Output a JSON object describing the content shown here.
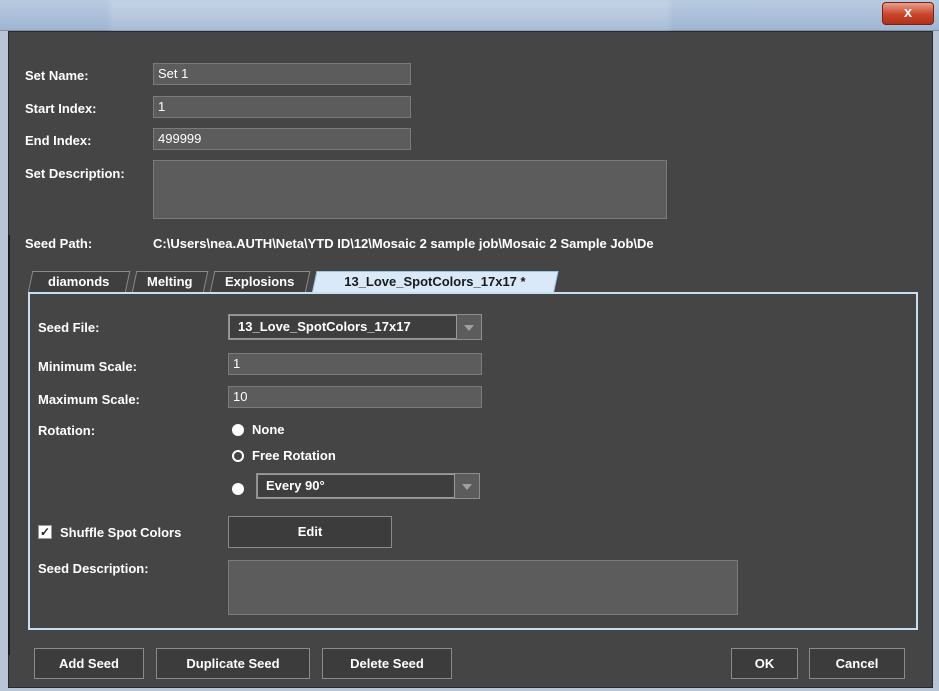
{
  "titlebar": {
    "close_symbol": "x"
  },
  "form": {
    "set_name_label": "Set Name:",
    "set_name_value": "Set 1",
    "start_index_label": "Start Index:",
    "start_index_value": "1",
    "end_index_label": "End Index:",
    "end_index_value": "499999",
    "set_description_label": "Set Description:",
    "seed_path_label": "Seed Path:",
    "seed_path_value": "C:\\Users\\nea.AUTH\\Neta\\YTD ID\\12\\Mosaic 2 sample job\\Mosaic 2 Sample Job\\De"
  },
  "tabs": [
    {
      "label": "diamonds",
      "active": false
    },
    {
      "label": "Melting",
      "active": false
    },
    {
      "label": "Explosions",
      "active": false
    },
    {
      "label": "13_Love_SpotColors_17x17 *",
      "active": true
    }
  ],
  "seed": {
    "seed_file_label": "Seed File:",
    "seed_file_value": "13_Love_SpotColors_17x17",
    "min_scale_label": "Minimum Scale:",
    "min_scale_value": "1",
    "max_scale_label": "Maximum Scale:",
    "max_scale_value": "10",
    "rotation_label": "Rotation:",
    "rotation_none": "None",
    "rotation_free": "Free Rotation",
    "rotation_every_value": "Every 90°",
    "shuffle_label": "Shuffle Spot Colors",
    "shuffle_checked": true,
    "check_mark": "✓",
    "edit_button": "Edit",
    "seed_description_label": "Seed Description:"
  },
  "footer": {
    "add_seed": "Add Seed",
    "duplicate_seed": "Duplicate Seed",
    "delete_seed": "Delete Seed",
    "ok": "OK",
    "cancel": "Cancel"
  },
  "colors": {
    "background": "#454545",
    "field": "#5c5c5c",
    "active_tab": "#d9e9f8",
    "panel_border": "#c8dff2",
    "close_button": "#c8442a"
  }
}
